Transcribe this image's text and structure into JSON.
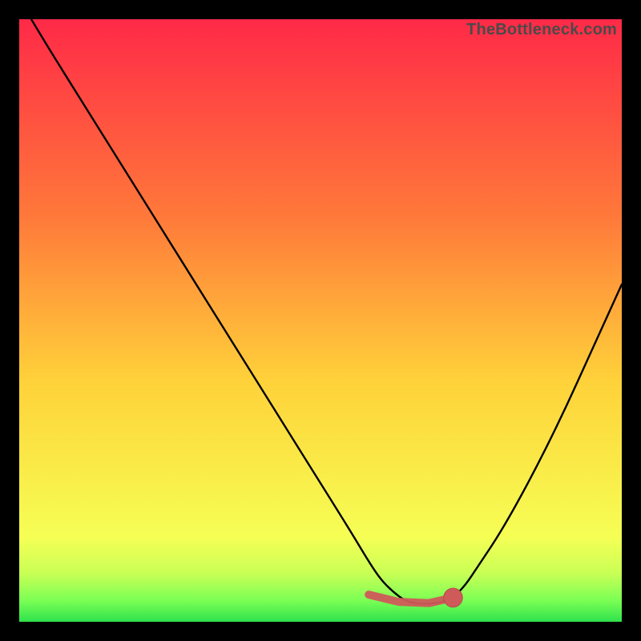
{
  "watermark": "TheBottleneck.com",
  "colors": {
    "frame": "#000000",
    "curve": "#000000",
    "marker_fill": "#cf5a5a",
    "marker_stroke": "#b74a4a",
    "gradient_top": "#ff2a48",
    "gradient_mid1": "#ff7a3a",
    "gradient_mid2": "#ffd23a",
    "gradient_mid3": "#f6ff55",
    "gradient_bottom": "#2fe24d"
  },
  "chart_data": {
    "type": "line",
    "title": "",
    "xlabel": "",
    "ylabel": "",
    "xlim": [
      0,
      100
    ],
    "ylim": [
      0,
      100
    ],
    "grid": false,
    "legend": false,
    "series": [
      {
        "name": "bottleneck-curve",
        "x": [
          2,
          5,
          10,
          15,
          20,
          25,
          30,
          35,
          40,
          45,
          50,
          55,
          58,
          60,
          62,
          64,
          66,
          68,
          70,
          72,
          74,
          76,
          80,
          85,
          90,
          95,
          100
        ],
        "y": [
          100,
          95,
          87,
          79,
          71,
          63,
          55,
          47,
          39,
          31,
          23,
          15,
          10,
          7,
          5,
          3.5,
          3,
          3,
          3.2,
          4,
          6,
          9,
          15,
          24,
          34,
          45,
          56
        ]
      }
    ],
    "markers": {
      "name": "trough-markers",
      "style": "line-with-endcap",
      "points": [
        {
          "x": 58,
          "y": 4.5
        },
        {
          "x": 63,
          "y": 3.3
        },
        {
          "x": 68,
          "y": 3.1
        },
        {
          "x": 72,
          "y": 4.0
        }
      ],
      "end_dot": {
        "x": 72,
        "y": 4.0,
        "r": 1.8
      }
    }
  }
}
